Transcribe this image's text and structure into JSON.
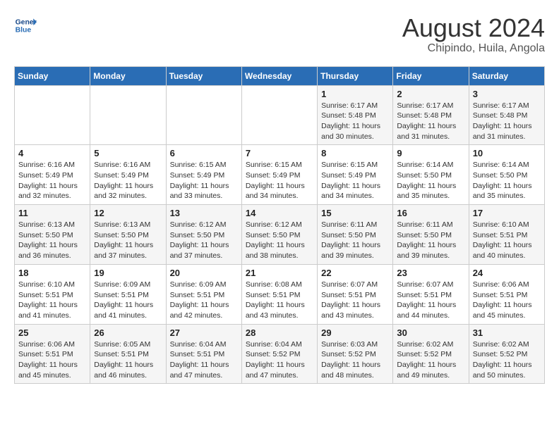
{
  "header": {
    "logo_text_general": "General",
    "logo_text_blue": "Blue",
    "main_title": "August 2024",
    "subtitle": "Chipindo, Huila, Angola"
  },
  "weekdays": [
    "Sunday",
    "Monday",
    "Tuesday",
    "Wednesday",
    "Thursday",
    "Friday",
    "Saturday"
  ],
  "weeks": [
    [
      {
        "day": "",
        "sunrise": "",
        "sunset": "",
        "daylight": ""
      },
      {
        "day": "",
        "sunrise": "",
        "sunset": "",
        "daylight": ""
      },
      {
        "day": "",
        "sunrise": "",
        "sunset": "",
        "daylight": ""
      },
      {
        "day": "",
        "sunrise": "",
        "sunset": "",
        "daylight": ""
      },
      {
        "day": "1",
        "sunrise": "6:17 AM",
        "sunset": "5:48 PM",
        "daylight": "11 hours and 30 minutes."
      },
      {
        "day": "2",
        "sunrise": "6:17 AM",
        "sunset": "5:48 PM",
        "daylight": "11 hours and 31 minutes."
      },
      {
        "day": "3",
        "sunrise": "6:17 AM",
        "sunset": "5:48 PM",
        "daylight": "11 hours and 31 minutes."
      }
    ],
    [
      {
        "day": "4",
        "sunrise": "6:16 AM",
        "sunset": "5:49 PM",
        "daylight": "11 hours and 32 minutes."
      },
      {
        "day": "5",
        "sunrise": "6:16 AM",
        "sunset": "5:49 PM",
        "daylight": "11 hours and 32 minutes."
      },
      {
        "day": "6",
        "sunrise": "6:15 AM",
        "sunset": "5:49 PM",
        "daylight": "11 hours and 33 minutes."
      },
      {
        "day": "7",
        "sunrise": "6:15 AM",
        "sunset": "5:49 PM",
        "daylight": "11 hours and 34 minutes."
      },
      {
        "day": "8",
        "sunrise": "6:15 AM",
        "sunset": "5:49 PM",
        "daylight": "11 hours and 34 minutes."
      },
      {
        "day": "9",
        "sunrise": "6:14 AM",
        "sunset": "5:50 PM",
        "daylight": "11 hours and 35 minutes."
      },
      {
        "day": "10",
        "sunrise": "6:14 AM",
        "sunset": "5:50 PM",
        "daylight": "11 hours and 35 minutes."
      }
    ],
    [
      {
        "day": "11",
        "sunrise": "6:13 AM",
        "sunset": "5:50 PM",
        "daylight": "11 hours and 36 minutes."
      },
      {
        "day": "12",
        "sunrise": "6:13 AM",
        "sunset": "5:50 PM",
        "daylight": "11 hours and 37 minutes."
      },
      {
        "day": "13",
        "sunrise": "6:12 AM",
        "sunset": "5:50 PM",
        "daylight": "11 hours and 37 minutes."
      },
      {
        "day": "14",
        "sunrise": "6:12 AM",
        "sunset": "5:50 PM",
        "daylight": "11 hours and 38 minutes."
      },
      {
        "day": "15",
        "sunrise": "6:11 AM",
        "sunset": "5:50 PM",
        "daylight": "11 hours and 39 minutes."
      },
      {
        "day": "16",
        "sunrise": "6:11 AM",
        "sunset": "5:50 PM",
        "daylight": "11 hours and 39 minutes."
      },
      {
        "day": "17",
        "sunrise": "6:10 AM",
        "sunset": "5:51 PM",
        "daylight": "11 hours and 40 minutes."
      }
    ],
    [
      {
        "day": "18",
        "sunrise": "6:10 AM",
        "sunset": "5:51 PM",
        "daylight": "11 hours and 41 minutes."
      },
      {
        "day": "19",
        "sunrise": "6:09 AM",
        "sunset": "5:51 PM",
        "daylight": "11 hours and 41 minutes."
      },
      {
        "day": "20",
        "sunrise": "6:09 AM",
        "sunset": "5:51 PM",
        "daylight": "11 hours and 42 minutes."
      },
      {
        "day": "21",
        "sunrise": "6:08 AM",
        "sunset": "5:51 PM",
        "daylight": "11 hours and 43 minutes."
      },
      {
        "day": "22",
        "sunrise": "6:07 AM",
        "sunset": "5:51 PM",
        "daylight": "11 hours and 43 minutes."
      },
      {
        "day": "23",
        "sunrise": "6:07 AM",
        "sunset": "5:51 PM",
        "daylight": "11 hours and 44 minutes."
      },
      {
        "day": "24",
        "sunrise": "6:06 AM",
        "sunset": "5:51 PM",
        "daylight": "11 hours and 45 minutes."
      }
    ],
    [
      {
        "day": "25",
        "sunrise": "6:06 AM",
        "sunset": "5:51 PM",
        "daylight": "11 hours and 45 minutes."
      },
      {
        "day": "26",
        "sunrise": "6:05 AM",
        "sunset": "5:51 PM",
        "daylight": "11 hours and 46 minutes."
      },
      {
        "day": "27",
        "sunrise": "6:04 AM",
        "sunset": "5:51 PM",
        "daylight": "11 hours and 47 minutes."
      },
      {
        "day": "28",
        "sunrise": "6:04 AM",
        "sunset": "5:52 PM",
        "daylight": "11 hours and 47 minutes."
      },
      {
        "day": "29",
        "sunrise": "6:03 AM",
        "sunset": "5:52 PM",
        "daylight": "11 hours and 48 minutes."
      },
      {
        "day": "30",
        "sunrise": "6:02 AM",
        "sunset": "5:52 PM",
        "daylight": "11 hours and 49 minutes."
      },
      {
        "day": "31",
        "sunrise": "6:02 AM",
        "sunset": "5:52 PM",
        "daylight": "11 hours and 50 minutes."
      }
    ]
  ],
  "labels": {
    "sunrise_prefix": "Sunrise: ",
    "sunset_prefix": "Sunset: ",
    "daylight_label": "Daylight hours"
  }
}
